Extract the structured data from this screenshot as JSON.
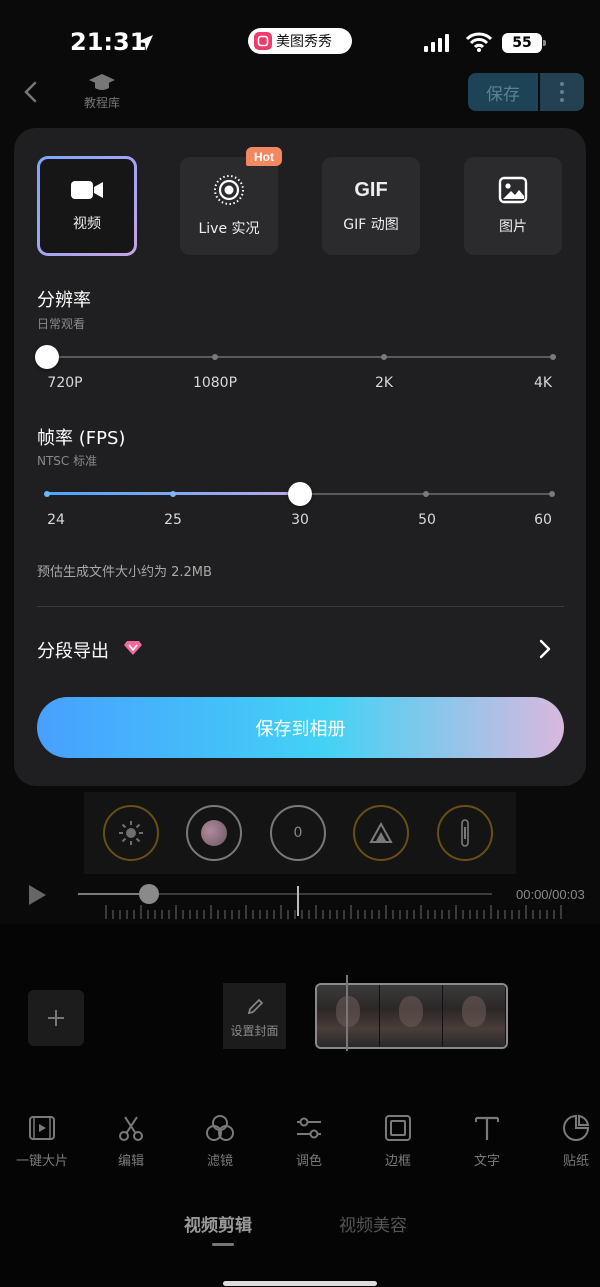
{
  "status_bar": {
    "time": "21:31",
    "app_pill": "美图秀秀",
    "battery": "55"
  },
  "header": {
    "tutorial_label": "教程库",
    "save_label": "保存"
  },
  "formats": [
    {
      "label": "视频",
      "icon": "video-camera-icon",
      "selected": true
    },
    {
      "label": "Live 实况",
      "icon": "live-photo-icon",
      "selected": false,
      "badge": "Hot"
    },
    {
      "label": "GIF 动图",
      "icon": "gif-icon",
      "glyph": "GIF",
      "selected": false
    },
    {
      "label": "图片",
      "icon": "image-icon",
      "selected": false
    }
  ],
  "resolution": {
    "title": "分辨率",
    "subtitle": "日常观看",
    "options": [
      "720P",
      "1080P",
      "2K",
      "4K"
    ],
    "selected": "720P"
  },
  "framerate": {
    "title": "帧率 (FPS)",
    "subtitle": "NTSC 标准",
    "options": [
      "24",
      "25",
      "30",
      "50",
      "60"
    ],
    "selected": "30"
  },
  "estimate": "预估生成文件大小约为 2.2MB",
  "segment_export": "分段导出",
  "save_to_album": "保存到相册",
  "editor": {
    "circle_tool_value": "0",
    "time": "00:00/00:03",
    "cover_label": "设置封面",
    "tools": [
      "一键大片",
      "编辑",
      "滤镜",
      "调色",
      "边框",
      "文字",
      "贴纸"
    ],
    "tabs": [
      "视频剪辑",
      "视频美容"
    ]
  },
  "colors": {
    "accent_gradient_start": "#47a0ff",
    "accent_gradient_mid": "#43d2f5",
    "accent_gradient_end": "#d9b8df",
    "hot_badge": "#f2885f",
    "sheet_bg": "#1f1f21"
  }
}
